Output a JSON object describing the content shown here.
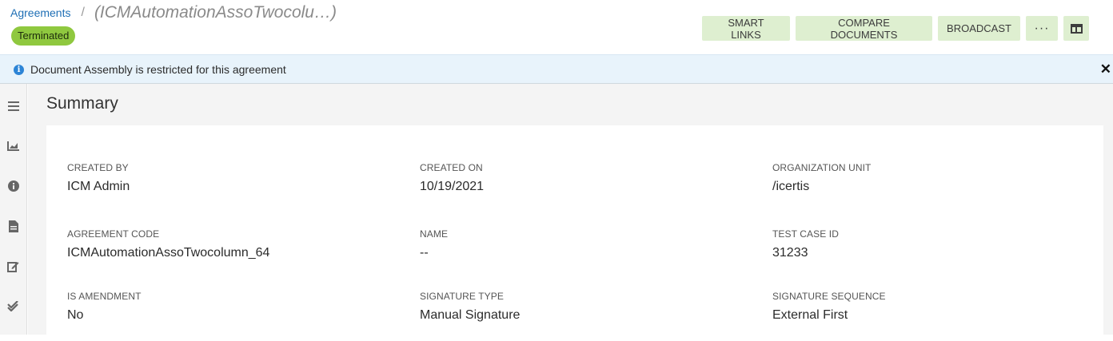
{
  "breadcrumb": {
    "root": "Agreements",
    "separator": "/",
    "current": "(ICMAutomationAssoTwocolu…)"
  },
  "status": {
    "label": "Terminated",
    "color": "#8fc83f"
  },
  "actions": {
    "smart_links": "SMART LINKS",
    "compare_documents": "COMPARE DOCUMENTS",
    "broadcast": "BROADCAST",
    "more": "···",
    "layout_icon": "split-view-icon"
  },
  "banner": {
    "icon": "info-icon",
    "text": "Document Assembly is restricted for this agreement",
    "close": "✕"
  },
  "sidenav": {
    "items": [
      {
        "icon": "menu-icon"
      },
      {
        "icon": "chart-icon"
      },
      {
        "icon": "info-icon"
      },
      {
        "icon": "document-icon"
      },
      {
        "icon": "edit-icon"
      },
      {
        "icon": "double-check-icon"
      }
    ]
  },
  "summary": {
    "title": "Summary",
    "fields": [
      {
        "label": "CREATED BY",
        "value": "ICM Admin"
      },
      {
        "label": "CREATED ON",
        "value": "10/19/2021"
      },
      {
        "label": "ORGANIZATION UNIT",
        "value": "/icertis"
      },
      {
        "label": "AGREEMENT CODE",
        "value": "ICMAutomationAssoTwocolumn_64"
      },
      {
        "label": "NAME",
        "value": "--"
      },
      {
        "label": "TEST CASE ID",
        "value": "31233"
      },
      {
        "label": "IS AMENDMENT",
        "value": "No"
      },
      {
        "label": "SIGNATURE TYPE",
        "value": "Manual Signature"
      },
      {
        "label": "SIGNATURE SEQUENCE",
        "value": "External First"
      }
    ]
  }
}
